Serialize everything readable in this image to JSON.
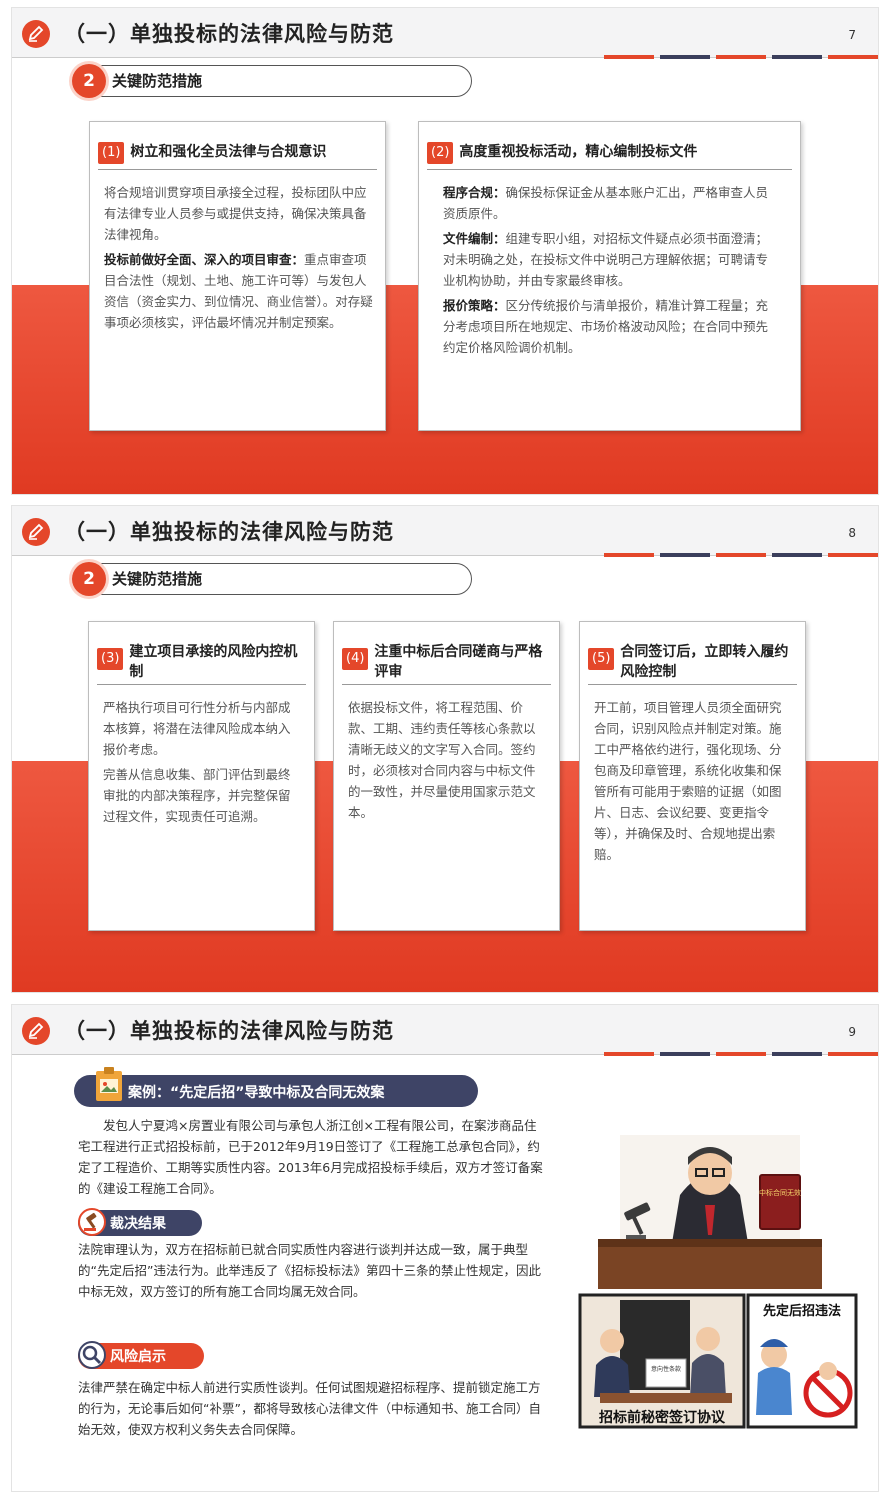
{
  "slide1": {
    "title": "（一）单独投标的法律风险与防范",
    "page": "7",
    "section": {
      "num": "2",
      "label": "关键防范措施"
    },
    "cards": [
      {
        "badge": "(1)",
        "title": "树立和强化全员法律与合规意识",
        "paras": [
          {
            "lead": "",
            "text": "将合规培训贯穿项目承接全过程，投标团队中应有法律专业人员参与或提供支持，确保决策具备法律视角。"
          },
          {
            "lead": "投标前做好全面、深入的项目审查：",
            "text": "重点审查项目合法性（规划、土地、施工许可等）与发包人资信（资金实力、到位情况、商业信誉）。对存疑事项必须核实，评估最坏情况并制定预案。"
          }
        ]
      },
      {
        "badge": "(2)",
        "title": "高度重视投标活动，精心编制投标文件",
        "paras": [
          {
            "lead": "程序合规：",
            "text": "确保投标保证金从基本账户汇出，严格审查人员资质原件。"
          },
          {
            "lead": "文件编制：",
            "text": "组建专职小组，对招标文件疑点必须书面澄清；对未明确之处，在投标文件中说明己方理解依据；可聘请专业机构协助，并由专家最终审核。"
          },
          {
            "lead": "报价策略：",
            "text": "区分传统报价与清单报价，精准计算工程量；充分考虑项目所在地规定、市场价格波动风险；在合同中预先约定价格风险调价机制。"
          }
        ]
      }
    ]
  },
  "slide2": {
    "title": "（一）单独投标的法律风险与防范",
    "page": "8",
    "section": {
      "num": "2",
      "label": "关键防范措施"
    },
    "cards": [
      {
        "badge": "(3)",
        "title": "建立项目承接的风险内控机制",
        "paras": [
          {
            "lead": "",
            "text": "严格执行项目可行性分析与内部成本核算，将潜在法律风险成本纳入报价考虑。"
          },
          {
            "lead": "",
            "text": "完善从信息收集、部门评估到最终审批的内部决策程序，并完整保留过程文件，实现责任可追溯。"
          }
        ]
      },
      {
        "badge": "(4)",
        "title": "注重中标后合同磋商与严格评审",
        "paras": [
          {
            "lead": "",
            "text": "依据投标文件，将工程范围、价款、工期、违约责任等核心条款以清晰无歧义的文字写入合同。签约时，必须核对合同内容与中标文件的一致性，并尽量使用国家示范文本。"
          }
        ]
      },
      {
        "badge": "(5)",
        "title": "合同签订后，立即转入履约风险控制",
        "paras": [
          {
            "lead": "",
            "text": "开工前，项目管理人员须全面研究合同，识别风险点并制定对策。施工中严格依约进行，强化现场、分包商及印章管理，系统化收集和保管所有可能用于索赔的证据（如图片、日志、会议纪要、变更指令等），并确保及时、合规地提出索赔。"
          }
        ]
      }
    ]
  },
  "slide3": {
    "title": "（一）单独投标的法律风险与防范",
    "page": "9",
    "case_label": "案例：“先定后招”导致中标及合同无效案",
    "case_text": "发包人宁夏鸿×房置业有限公司与承包人浙江创×工程有限公司，在案涉商品住宅工程进行正式招投标前，已于2012年9月19日签订了《工程施工总承包合同》，约定了工程造价、工期等实质性内容。2013年6月完成招投标手续后，双方才签订备案的《建设工程施工合同》。",
    "verdict_label": "裁决结果",
    "verdict_text": "法院审理认为，双方在招标前已就合同实质性内容进行谈判并达成一致，属于典型的“先定后招”违法行为。此举违反了《招标投标法》第四十三条的禁止性规定，因此中标无效，双方签订的所有施工合同均属无效合同。",
    "risk_label": "风险启示",
    "risk_text": "法律严禁在确定中标人前进行实质性谈判。任何试图规避招标程序、提前锁定施工方的行为，无论事后如何“补票”，都将导致核心法律文件（中标通知书、施工合同）自始无效，使双方权利义务失去合同保障。",
    "illustration": {
      "book_text": "中标合同无效",
      "doc_text": "意向性条款",
      "panel_right_title": "先定后招违法",
      "panel_left_caption": "招标前秘密签订协议"
    }
  },
  "colors": {
    "accent": "#e4472a",
    "navy": "#3e4466"
  }
}
